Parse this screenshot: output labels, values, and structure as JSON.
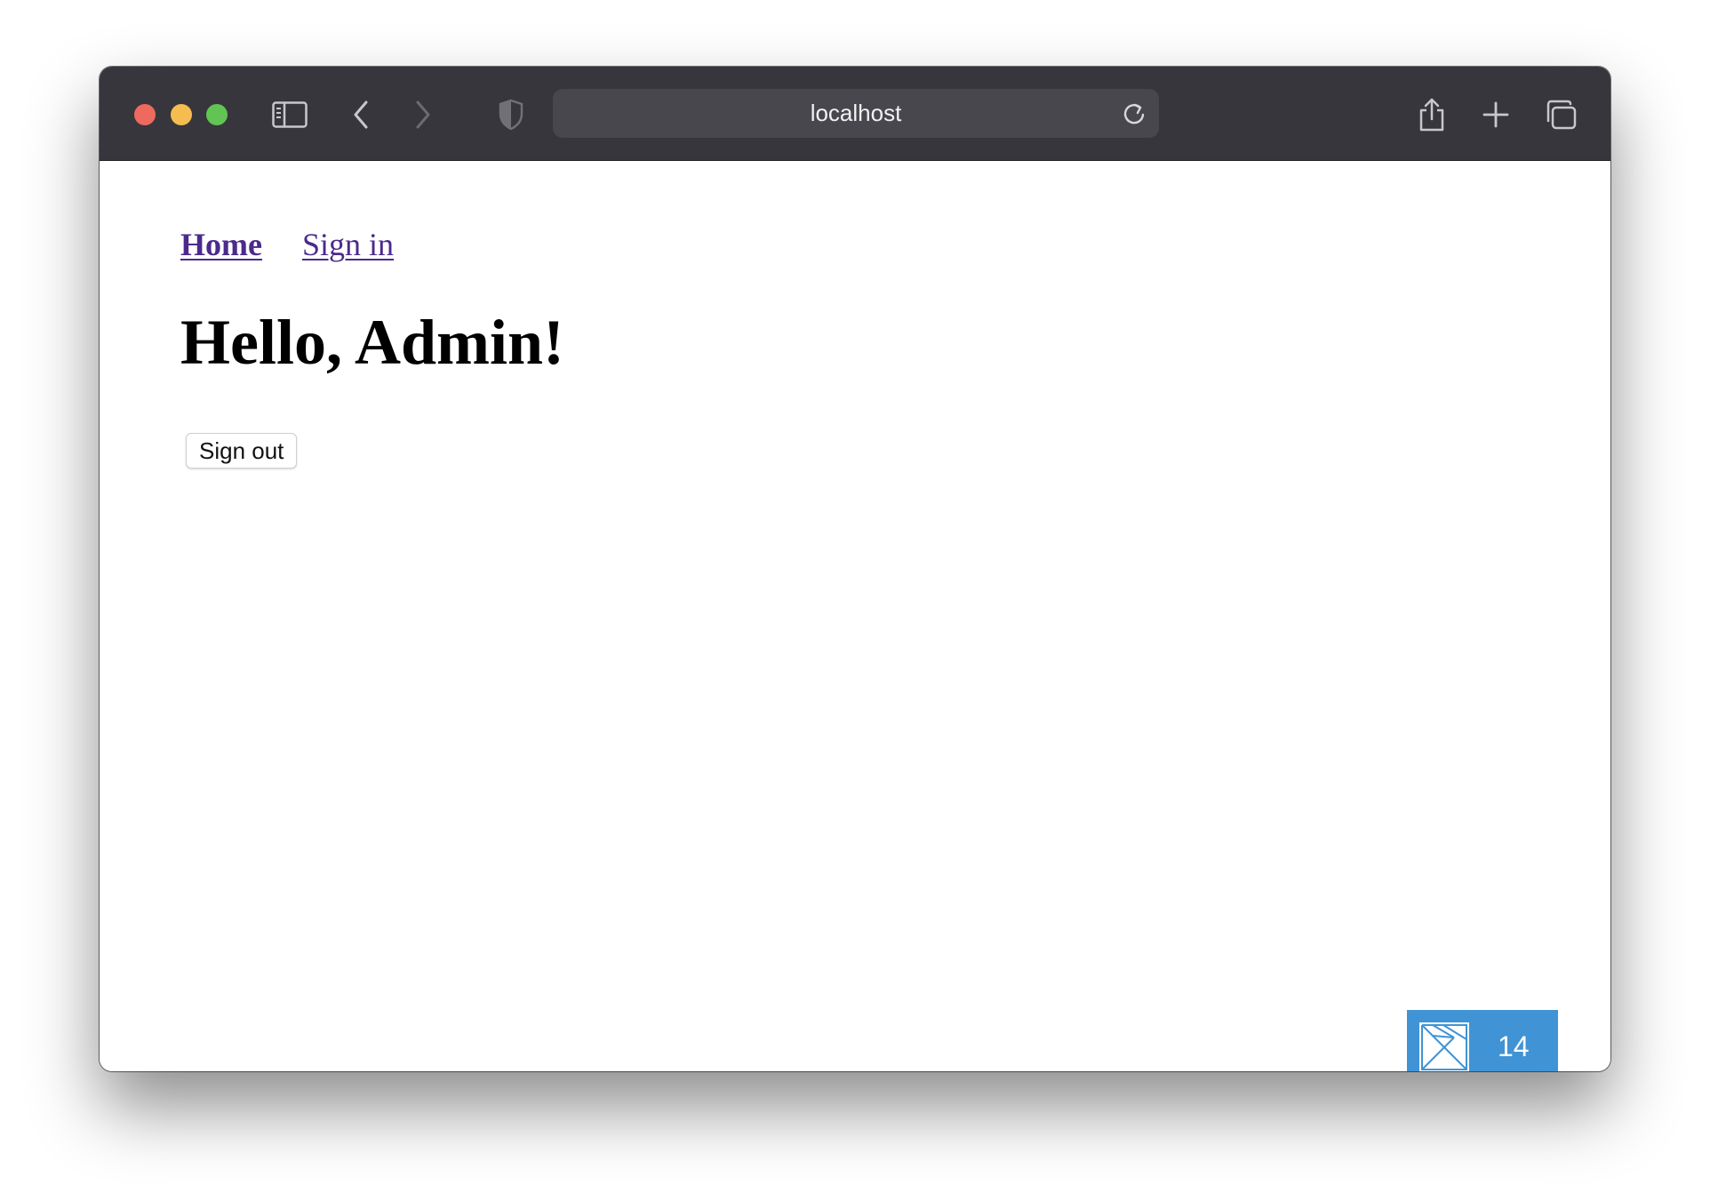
{
  "browser": {
    "url": "localhost",
    "colors": {
      "toolbar": "#37363c",
      "urlbar": "#48474d",
      "close": "#ee6a5e",
      "minimize": "#f5bd4f",
      "maximize": "#61c454"
    },
    "icons": [
      "sidebar-icon",
      "back-icon",
      "forward-icon",
      "shield-icon",
      "reload-icon",
      "share-icon",
      "new-tab-icon",
      "tabs-overview-icon"
    ]
  },
  "page": {
    "nav": {
      "home": "Home",
      "sign_in": "Sign in"
    },
    "heading": "Hello, Admin!",
    "sign_out_button": "Sign out",
    "link_color": "#4b2a8c"
  },
  "badge": {
    "count": "14",
    "color": "#4094d5"
  }
}
